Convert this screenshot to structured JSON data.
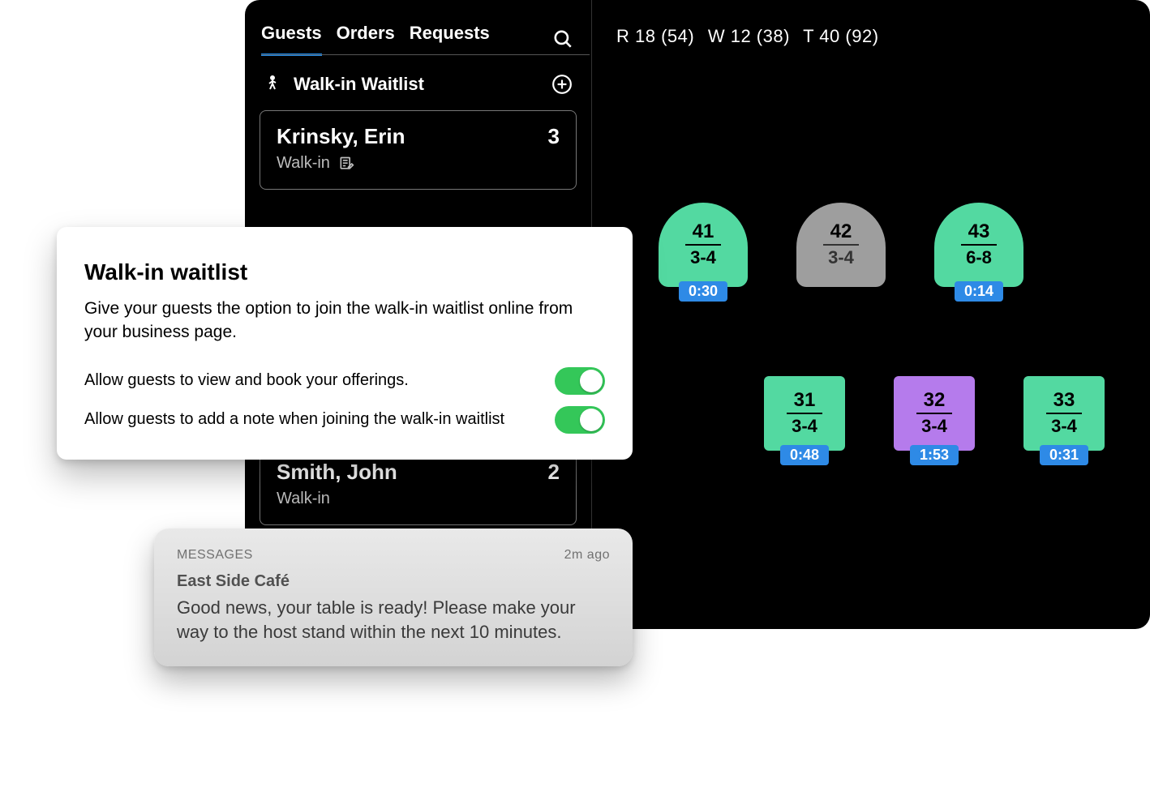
{
  "tabs": {
    "guests": "Guests",
    "orders": "Orders",
    "requests": "Requests"
  },
  "waitlist": {
    "header": "Walk-in Waitlist",
    "guests": [
      {
        "name": "Krinsky, Erin",
        "type": "Walk-in",
        "count": "3"
      },
      {
        "name": "Smith, John",
        "type": "Walk-in",
        "count": "2"
      }
    ]
  },
  "status": {
    "r": "R 18 (54)",
    "w": "W 12 (38)",
    "t": "T 40 (92)"
  },
  "tables": {
    "row1": [
      {
        "num": "41",
        "cap": "3-4",
        "color": "seated",
        "timer": "0:30"
      },
      {
        "num": "42",
        "cap": "3-4",
        "color": "empty"
      },
      {
        "num": "43",
        "cap": "6-8",
        "color": "seated",
        "timer": "0:14"
      }
    ],
    "row2": [
      {
        "num": "31",
        "cap": "3-4",
        "color": "seated",
        "timer": "0:48"
      },
      {
        "num": "32",
        "cap": "3-4",
        "color": "wait",
        "timer": "1:53"
      },
      {
        "num": "33",
        "cap": "3-4",
        "color": "seated",
        "timer": "0:31"
      }
    ]
  },
  "settings": {
    "title": "Walk-in waitlist",
    "lead": "Give your guests the option to join the walk-in waitlist online from your business page.",
    "opt1": "Allow guests to view and book your offerings.",
    "opt2": "Allow guests to add a note when joining the walk-in waitlist"
  },
  "notif": {
    "label": "MESSAGES",
    "time": "2m ago",
    "sender": "East Side Café",
    "body": "Good news, your table is ready! Please make your way to the host stand within the next 10 minutes."
  }
}
